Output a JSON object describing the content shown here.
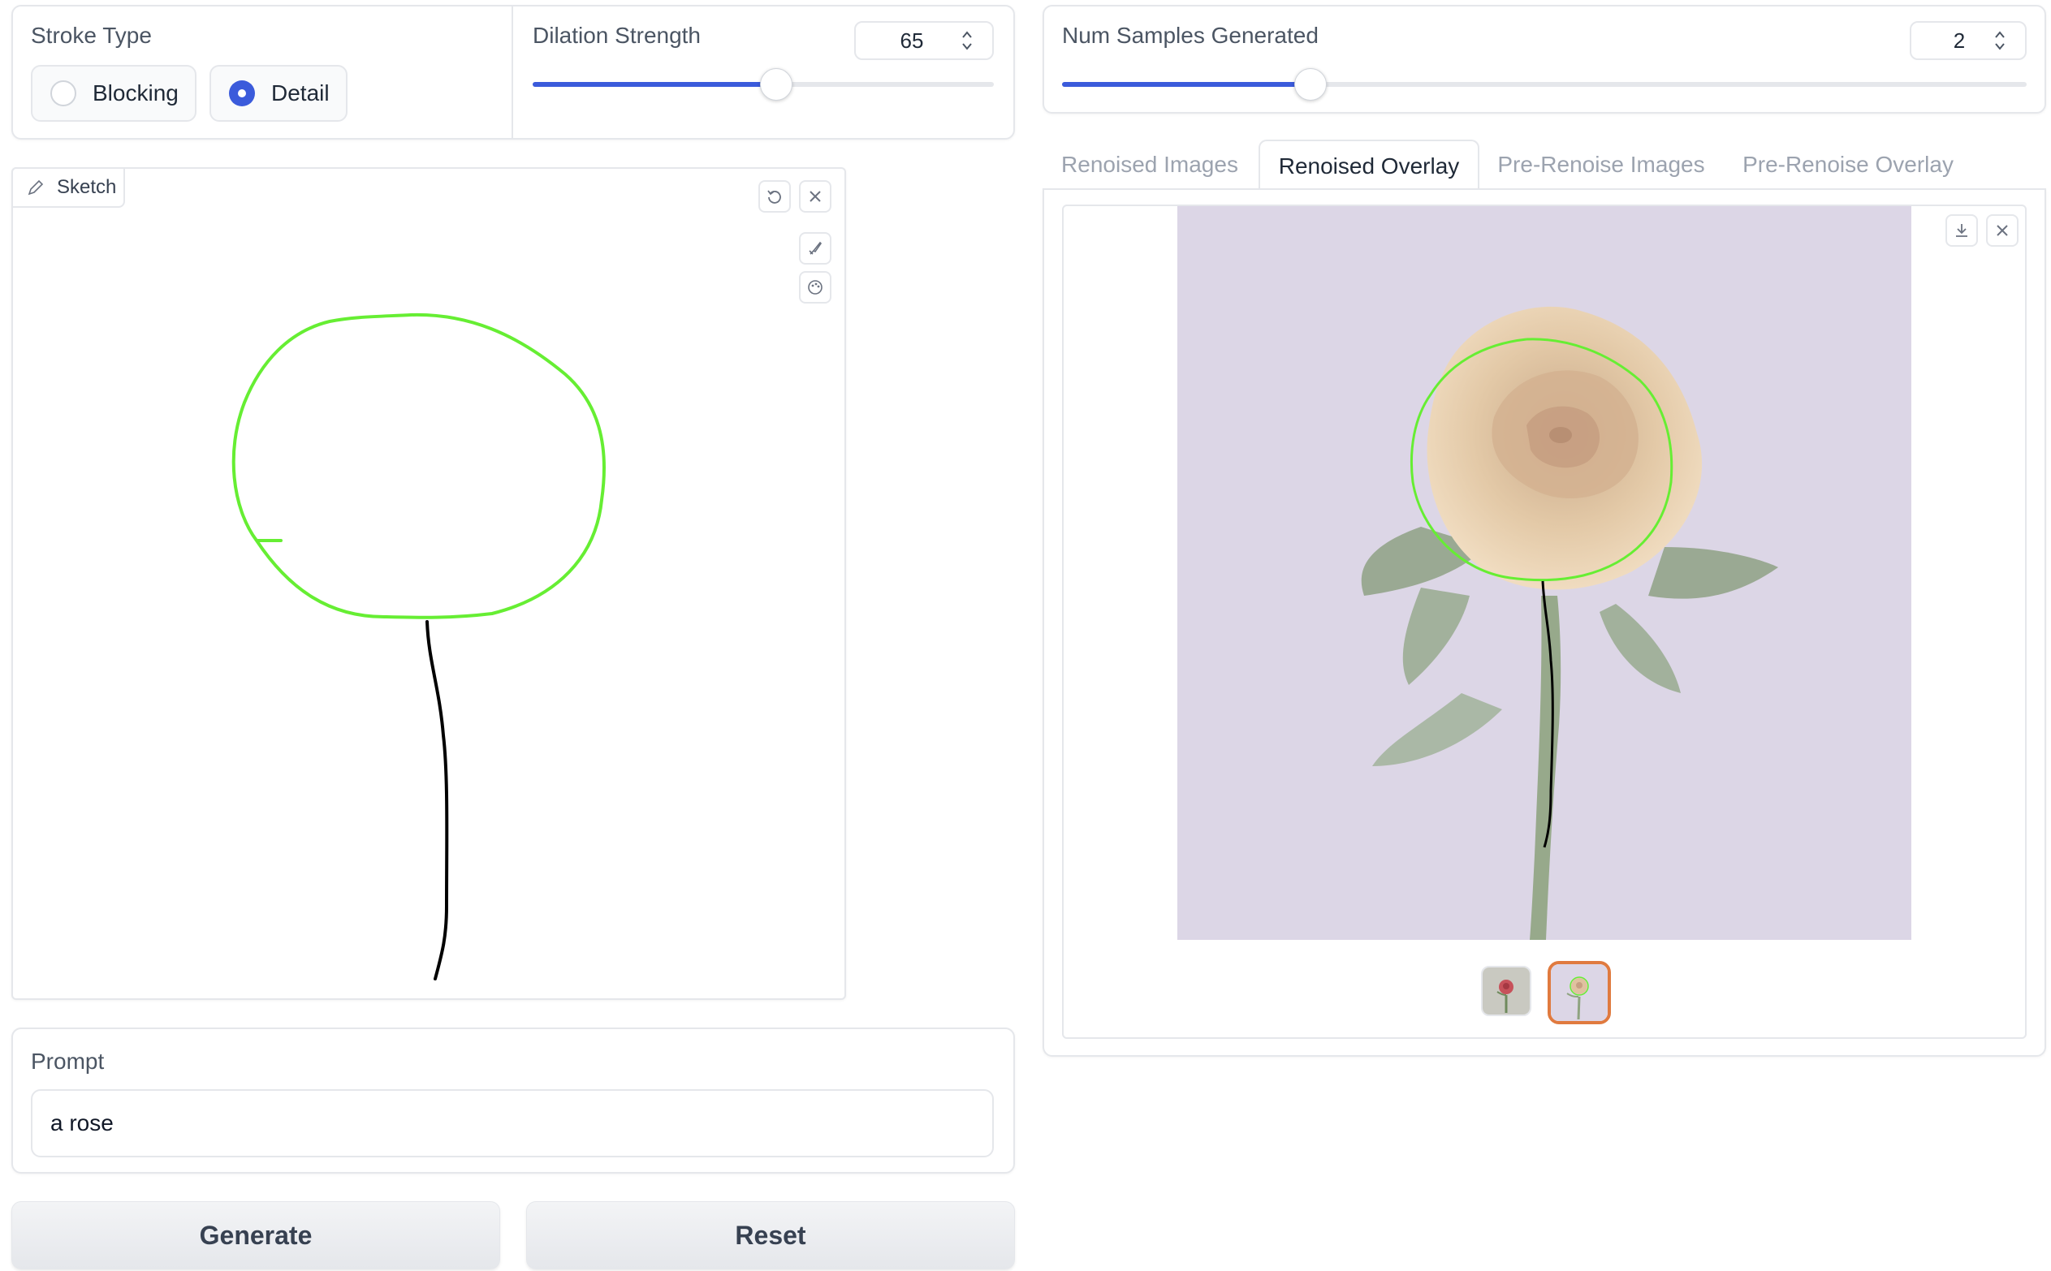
{
  "stroke_type": {
    "label": "Stroke Type",
    "options": [
      "Blocking",
      "Detail"
    ],
    "selected": "Detail"
  },
  "dilation": {
    "label": "Dilation Strength",
    "value": "65",
    "slider_fraction": 0.52
  },
  "num_samples": {
    "label": "Num Samples Generated",
    "value": "2",
    "slider_fraction": 0.25
  },
  "sketch": {
    "tab_label": "Sketch",
    "icons": [
      "undo-icon",
      "close-icon",
      "brush-icon",
      "palette-icon"
    ],
    "stroke_colors": {
      "circle": "#66ee33",
      "stem": "#000000"
    }
  },
  "prompt": {
    "label": "Prompt",
    "value": "a rose"
  },
  "buttons": {
    "generate": "Generate",
    "reset": "Reset"
  },
  "tabs": [
    {
      "label": "Renoised Images",
      "active": false
    },
    {
      "label": "Renoised Overlay",
      "active": true
    },
    {
      "label": "Pre-Renoise Images",
      "active": false
    },
    {
      "label": "Pre-Renoise Overlay",
      "active": false
    }
  ],
  "gallery": {
    "icons": [
      "download-icon",
      "close-icon"
    ],
    "thumbnail_count": 2,
    "selected_thumbnail": 2,
    "accent_color": "#e07a3f",
    "background_color": "#dcd6e6"
  },
  "colors": {
    "accent": "#3b5bdb",
    "border": "#e5e7eb"
  }
}
